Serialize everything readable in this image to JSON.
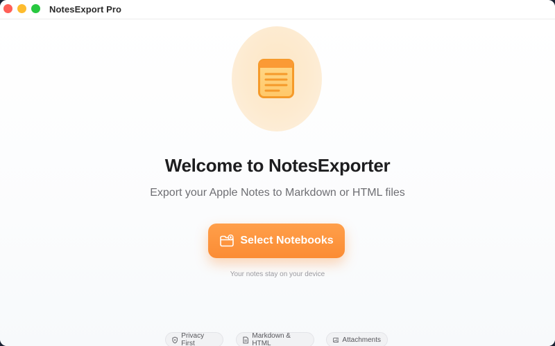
{
  "window": {
    "title": "NotesExport Pro"
  },
  "welcome": {
    "heading": "Welcome to NotesExporter",
    "subtitle": "Export your Apple Notes to Markdown or HTML files"
  },
  "primary_action": {
    "label": "Select Notebooks",
    "icon": "folder-plus-icon"
  },
  "hint": "Your notes stay on your device",
  "features": [
    {
      "label": "Privacy First",
      "icon": "shield-icon"
    },
    {
      "label": "Markdown & HTML",
      "icon": "document-icon"
    },
    {
      "label": "Attachments",
      "icon": "image-icon"
    }
  ],
  "colors": {
    "accent": "#fb8c34",
    "hero_background": "#fde6c4",
    "traffic_close": "#ff5f57",
    "traffic_minimize": "#febc2e",
    "traffic_maximize": "#28c840"
  }
}
